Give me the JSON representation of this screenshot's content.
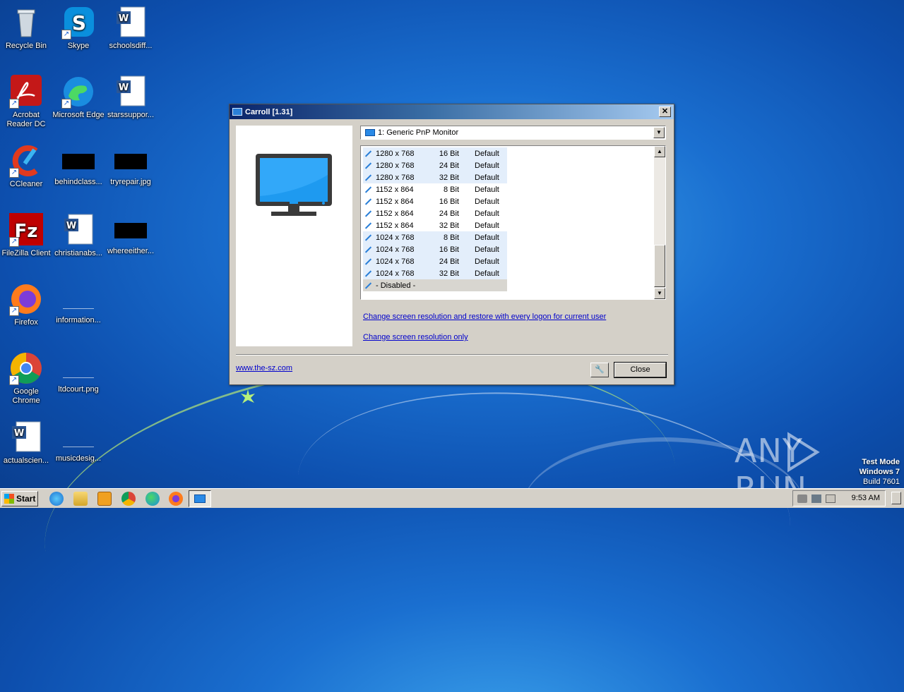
{
  "desktop": {
    "icons": [
      {
        "label": "Recycle Bin"
      },
      {
        "label": "Skype"
      },
      {
        "label": "schoolsdiff..."
      },
      {
        "label": "Acrobat Reader DC"
      },
      {
        "label": "Microsoft Edge"
      },
      {
        "label": "starssuppor..."
      },
      {
        "label": "CCleaner"
      },
      {
        "label": "behindclass..."
      },
      {
        "label": "tryrepair.jpg"
      },
      {
        "label": "FileZilla Client"
      },
      {
        "label": "christianabs..."
      },
      {
        "label": "whereeither..."
      },
      {
        "label": "Firefox"
      },
      {
        "label": "information..."
      },
      {
        "label": "Google Chrome"
      },
      {
        "label": "ltdcourt.png"
      },
      {
        "label": "actualscien..."
      },
      {
        "label": "musicdesig..."
      }
    ]
  },
  "dialog": {
    "title": "Carroll [1.31]",
    "monitor_select": "1: Generic PnP Monitor",
    "modes": [
      {
        "res": "1280 x 768",
        "bits": "16 Bit",
        "freq": "Default"
      },
      {
        "res": "1280 x 768",
        "bits": "24 Bit",
        "freq": "Default"
      },
      {
        "res": "1280 x 768",
        "bits": "32 Bit",
        "freq": "Default"
      },
      {
        "res": "1152 x 864",
        "bits": "8 Bit",
        "freq": "Default"
      },
      {
        "res": "1152 x 864",
        "bits": "16 Bit",
        "freq": "Default"
      },
      {
        "res": "1152 x 864",
        "bits": "24 Bit",
        "freq": "Default"
      },
      {
        "res": "1152 x 864",
        "bits": "32 Bit",
        "freq": "Default"
      },
      {
        "res": "1024 x 768",
        "bits": "8 Bit",
        "freq": "Default"
      },
      {
        "res": "1024 x 768",
        "bits": "16 Bit",
        "freq": "Default"
      },
      {
        "res": "1024 x 768",
        "bits": "24 Bit",
        "freq": "Default"
      },
      {
        "res": "1024 x 768",
        "bits": "32 Bit",
        "freq": "Default"
      }
    ],
    "disabled_label": "- Disabled -",
    "link_restore": "Change screen resolution and restore with every logon for current user",
    "link_only": "Change screen resolution only",
    "website": "www.the-sz.com",
    "close_label": "Close"
  },
  "watermark": {
    "brand_left": "ANY",
    "brand_right": "RUN",
    "line1": "Test Mode",
    "line2": "Windows 7",
    "line3": "Build 7601"
  },
  "taskbar": {
    "start_label": "Start",
    "time": "9:53 AM"
  }
}
